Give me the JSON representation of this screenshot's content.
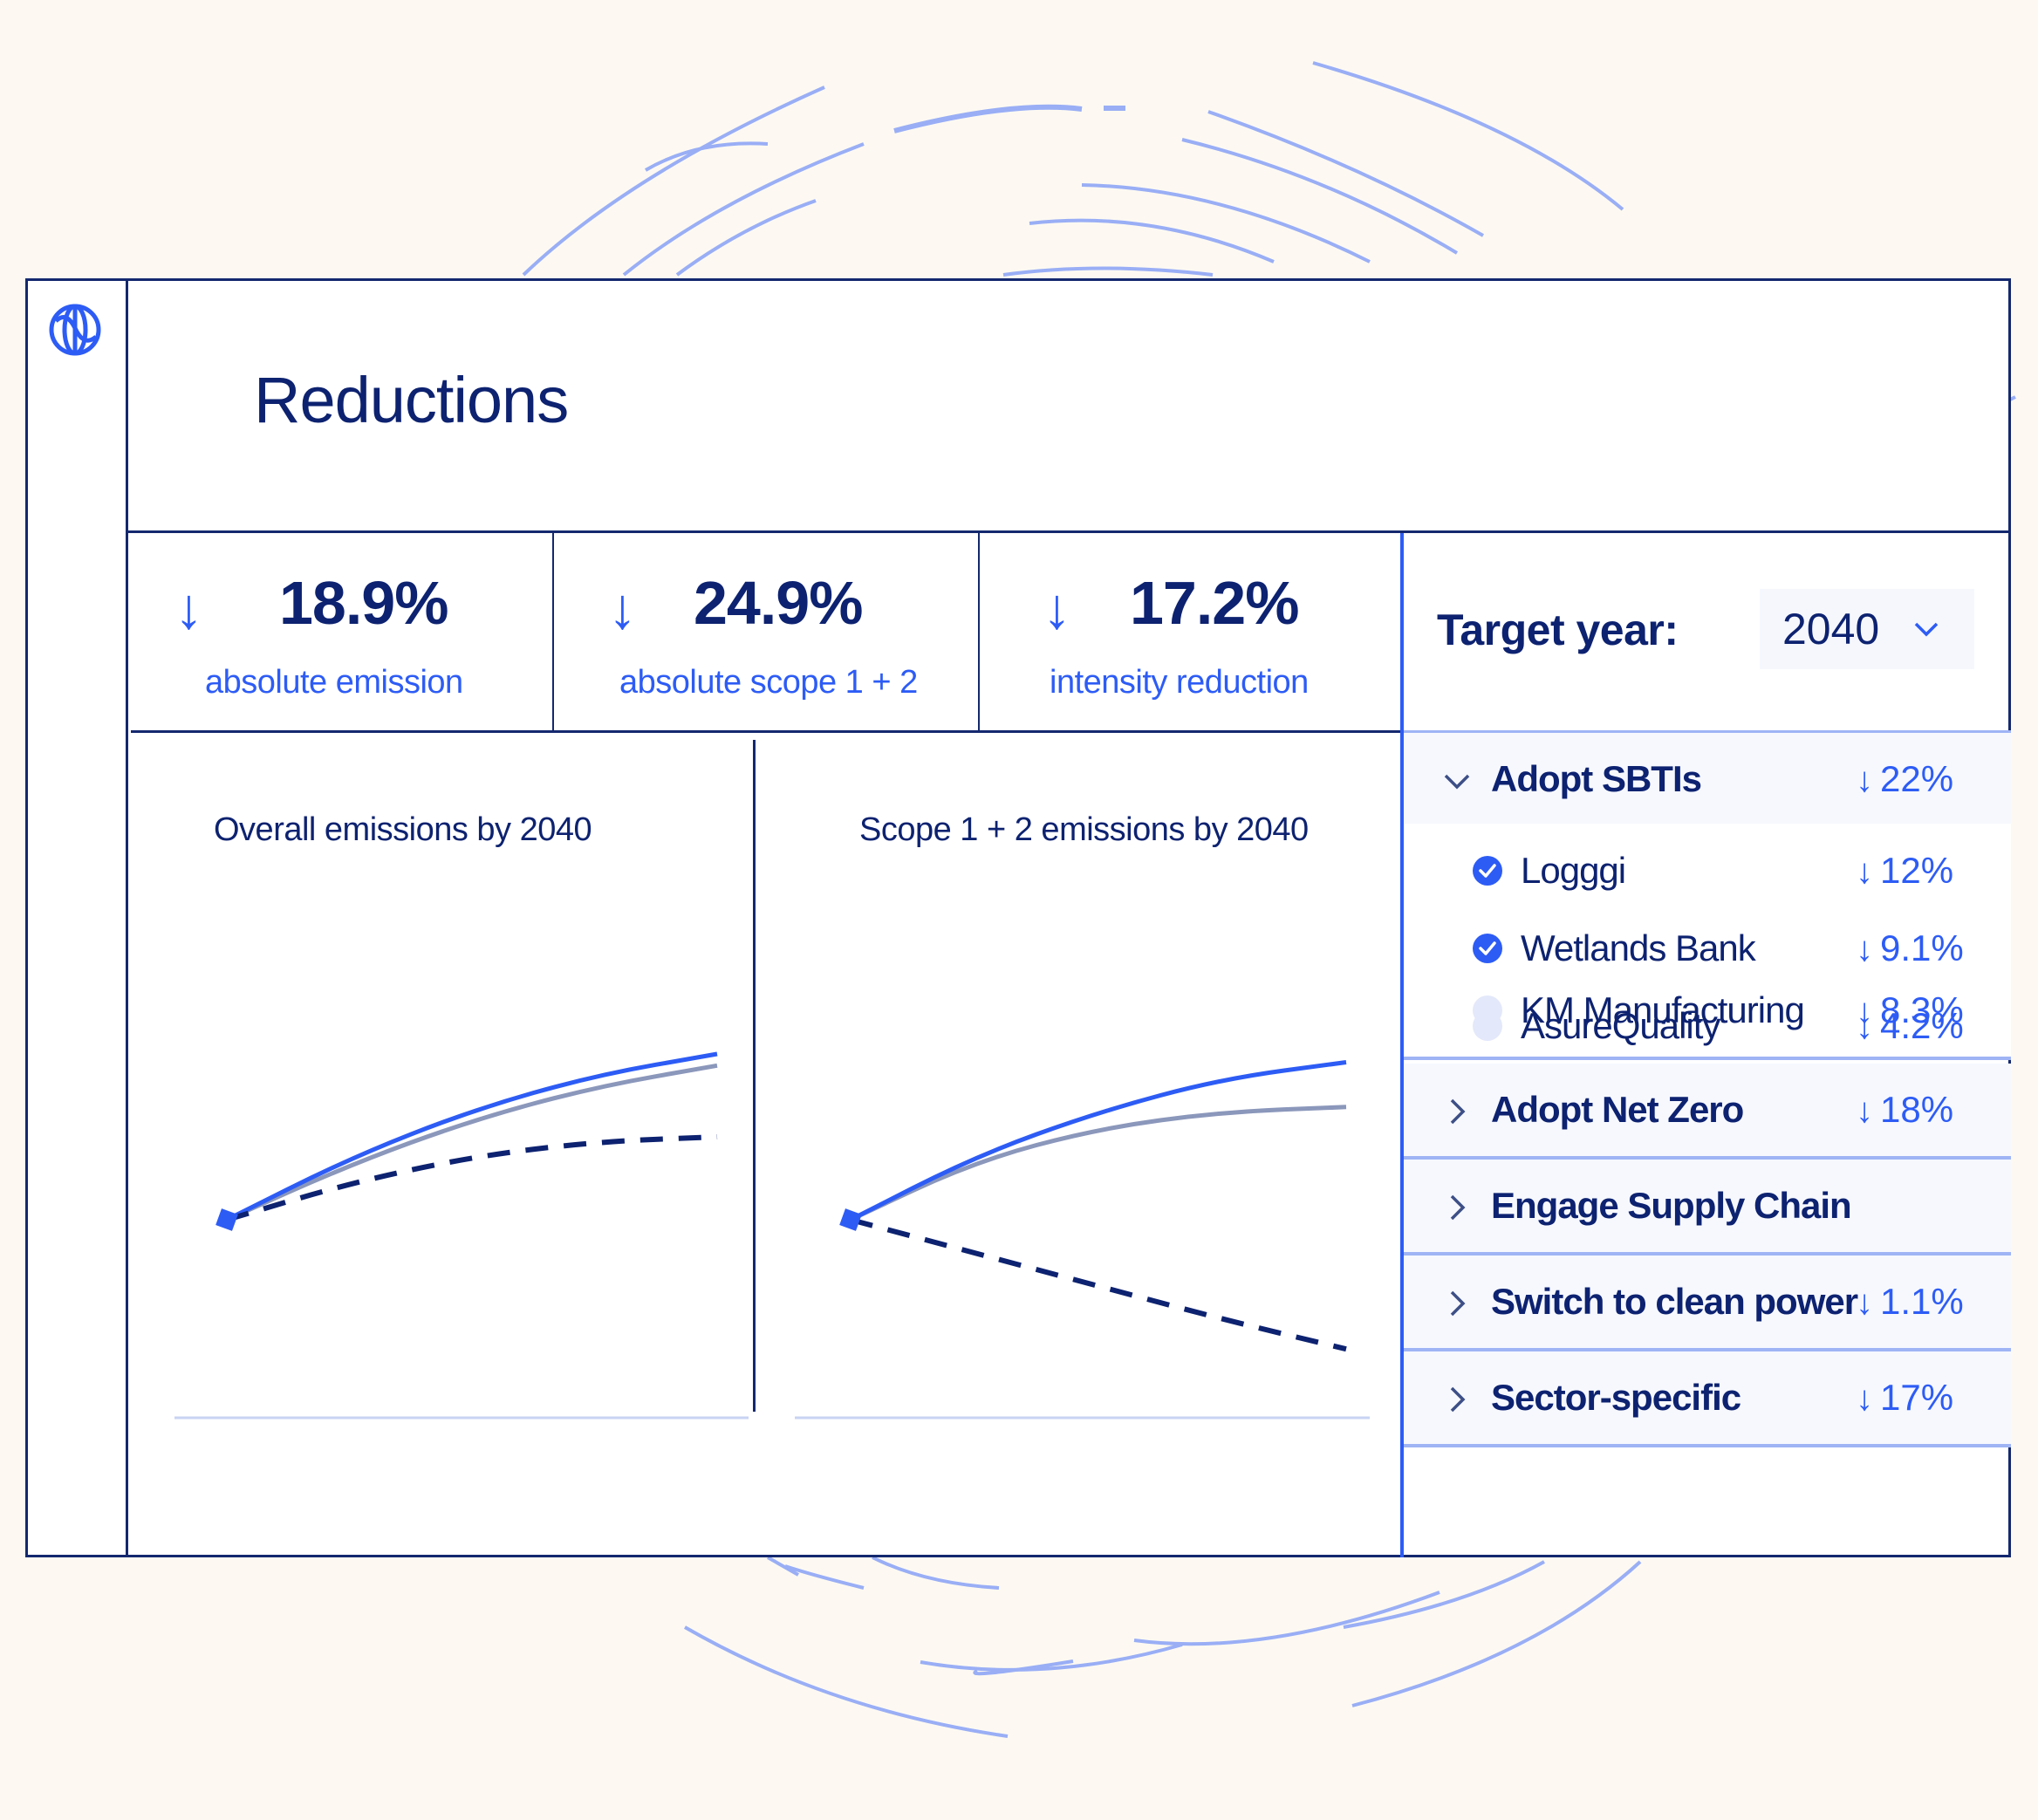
{
  "app": {
    "logo_icon": "globe-icon",
    "page_title": "Reductions"
  },
  "kpis": [
    {
      "icon": "arrow-down-icon",
      "arrow": "↓",
      "value": "18.9%",
      "label": "absolute emission"
    },
    {
      "icon": "arrow-down-icon",
      "arrow": "↓",
      "value": "24.9%",
      "label": "absolute scope 1 + 2"
    },
    {
      "icon": "arrow-down-icon",
      "arrow": "↓",
      "value": "17.2%",
      "label": "intensity reduction"
    }
  ],
  "target_year": {
    "label": "Target year:",
    "selected": "2040",
    "chevron_icon": "chevron-down-icon"
  },
  "levers": {
    "groups": [
      {
        "name": "Adopt SBTIs",
        "pct": "22%",
        "expanded": true,
        "items": [
          {
            "name": "Logggi",
            "pct": "12%",
            "checked": true
          },
          {
            "name": "Wetlands Bank",
            "pct": "9.1%",
            "checked": true
          },
          {
            "name": "AsureQuality",
            "pct": "4.2%",
            "checked": false
          },
          {
            "name": "KM Manufacturing",
            "pct": "8.3%",
            "checked": false
          }
        ]
      },
      {
        "name": "Adopt Net Zero",
        "pct": "18%",
        "expanded": false
      },
      {
        "name": "Engage Supply Chain",
        "pct": "",
        "expanded": false
      },
      {
        "name": "Switch to clean power",
        "pct": "1.1%",
        "expanded": false
      },
      {
        "name": "Sector-specific",
        "pct": "17%",
        "expanded": false
      }
    ],
    "down_arrow": "↓"
  },
  "colors": {
    "accent": "#2d5cf5",
    "navy": "#0d2270",
    "gray_line": "#8b97bb",
    "separator": "#9fb4f5",
    "background": "#fdf9f2"
  },
  "chart_data": [
    {
      "type": "line",
      "title": "Overall emissions by 2040",
      "xlabel": "",
      "ylabel": "",
      "x": [
        0,
        0.25,
        0.5,
        0.75,
        1
      ],
      "series": [
        {
          "name": "projection-blue",
          "style": "solid",
          "color": "#2d5cf5",
          "values": [
            0,
            0.37,
            0.66,
            0.87,
            1.0
          ]
        },
        {
          "name": "projection-gray",
          "style": "solid",
          "color": "#8b97bb",
          "values": [
            0,
            0.33,
            0.6,
            0.8,
            0.93
          ]
        },
        {
          "name": "target-dashed",
          "style": "dashed",
          "color": "#0d2270",
          "values": [
            0,
            0.22,
            0.38,
            0.47,
            0.5
          ]
        }
      ],
      "ylim": [
        -1.0,
        2.0
      ],
      "grid": false
    },
    {
      "type": "line",
      "title": "Scope 1 + 2  emissions by 2040",
      "xlabel": "",
      "ylabel": "",
      "x": [
        0,
        0.25,
        0.5,
        0.75,
        1
      ],
      "series": [
        {
          "name": "projection-blue",
          "style": "solid",
          "color": "#2d5cf5",
          "values": [
            0,
            0.38,
            0.65,
            0.85,
            0.95
          ]
        },
        {
          "name": "projection-gray",
          "style": "solid",
          "color": "#8b97bb",
          "values": [
            0,
            0.35,
            0.55,
            0.65,
            0.68
          ]
        },
        {
          "name": "target-dashed",
          "style": "dashed",
          "color": "#0d2270",
          "values": [
            0,
            -0.2,
            -0.4,
            -0.6,
            -0.78
          ]
        }
      ],
      "ylim": [
        -1.0,
        2.0
      ],
      "grid": false
    }
  ]
}
